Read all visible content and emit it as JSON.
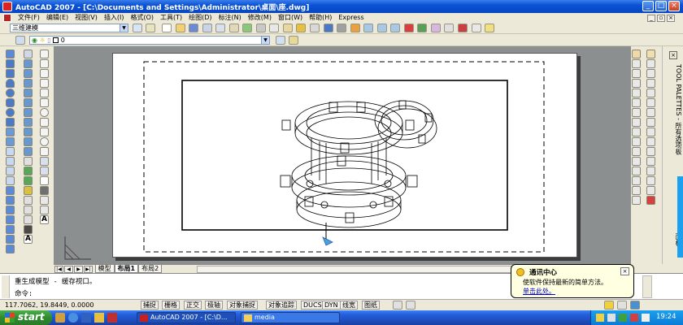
{
  "window": {
    "title": "AutoCAD 2007 - [C:\\Documents and Settings\\Administrator\\桌面\\座.dwg]"
  },
  "menu": {
    "items": [
      "文件(F)",
      "编辑(E)",
      "视图(V)",
      "插入(I)",
      "格式(O)",
      "工具(T)",
      "绘图(D)",
      "标注(N)",
      "修改(M)",
      "窗口(W)",
      "帮助(H)",
      "Express"
    ]
  },
  "toolbar": {
    "workspace": "三维建模",
    "layer": "0"
  },
  "tool_palette": {
    "title": "TOOL PALETTES - 所有选项板",
    "tab": "面板"
  },
  "layout_tabs": [
    "模型",
    "布局1",
    "布局2"
  ],
  "command": {
    "history": "重生成模型 - 缓存视口。",
    "prompt": "命令:"
  },
  "status": {
    "coords": "117.7062, 19.8449, 0.0000",
    "toggles": [
      "捕捉",
      "栅格",
      "正交",
      "极轴",
      "对象捕捉",
      "对象追踪",
      "DUCS",
      "DYN",
      "线宽",
      "图纸"
    ]
  },
  "comm_center": {
    "title": "通讯中心",
    "message": "使软件保持最新的简单方法。",
    "link": "单击此处。"
  },
  "taskbar": {
    "start": "start",
    "tasks": [
      "AutoCAD 2007 - [C:\\D...",
      "media"
    ],
    "clock": "19:24"
  },
  "colors": {
    "title_blue": "#0a52d6",
    "paper_bg": "#ffffff",
    "model_space": "#8b8f8f",
    "start_green": "#2f8a2f",
    "link_blue": "#0000cc"
  }
}
